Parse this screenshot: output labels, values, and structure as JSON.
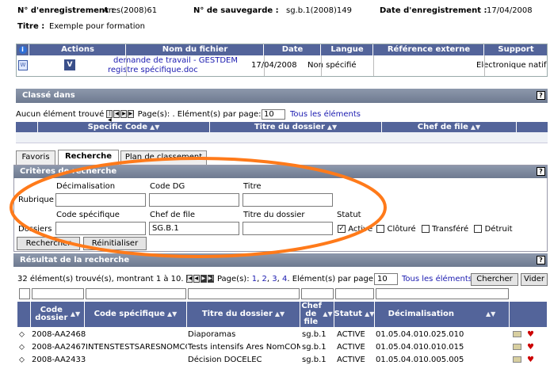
{
  "record": {
    "enr_label": "N° d'enregistrement :",
    "enr_value": "Ares(2008)61",
    "sauv_label": "N° de sauvegarde :",
    "sauv_value": "sg.b.1(2008)149",
    "date_label": "Date d'enregistrement :",
    "date_value": "17/04/2008",
    "titre_label": "Titre :",
    "titre_value": "Exemple pour formation"
  },
  "attachments": {
    "headers": [
      "Actions",
      "Nom du fichier",
      "Date",
      "Langue",
      "Référence externe",
      "Support"
    ],
    "row": {
      "file_line1": "demande de travail - GESTDEM",
      "file_line2": "registre spécifique.doc",
      "date": "17/04/2008",
      "langue": "Non spécifié",
      "ref": "",
      "support": "Electronique natif"
    }
  },
  "classe": {
    "title": "Classé dans",
    "pager_prefix": "Aucun élément trouvé",
    "pager_pages": "Page(s): . Elément(s) par page:",
    "per_page": "10",
    "all_link": "Tous les éléments",
    "headers": [
      "Specific Code",
      "Titre du dossier",
      "Chef de file"
    ]
  },
  "tabs": [
    "Favoris",
    "Recherche",
    "Plan de classement"
  ],
  "criteria": {
    "title": "Critères de recherche",
    "rubrique_label": "Rubrique",
    "dossiers_label": "Dossiers",
    "decimalisation_label": "Décimalisation",
    "code_dg_label": "Code DG",
    "titre_label": "Titre",
    "code_spec_label": "Code spécifique",
    "chef_label": "Chef de file",
    "titre_dossier_label": "Titre du dossier",
    "chef_value": "SG.B.1",
    "statut_label": "Statut",
    "statut_options": [
      "Active",
      "Clôturé",
      "Transféré",
      "Détruit"
    ],
    "search_btn": "Rechercher",
    "reset_btn": "Réinitialiser"
  },
  "results": {
    "title": "Résultat de la recherche",
    "count_text": "32 élément(s) trouvé(s), montrant 1 à 10.",
    "pages_label": "Page(s):",
    "pages": [
      "1",
      "2",
      "3",
      "4"
    ],
    "per_page_label": "Elément(s) par page:",
    "per_page": "10",
    "all_link": "Tous les éléments",
    "search_btn": "Chercher",
    "clear_btn": "Vider",
    "headers": [
      "Code dossier",
      "Code spécifique",
      "Titre du dossier",
      "Chef de file",
      "Statut",
      "Décimalisation"
    ],
    "rows": [
      {
        "code": "2008-AA2468",
        "spec": "",
        "titre": "Diaporamas",
        "chef": "sg.b.1",
        "statut": "ACTIVE",
        "dec": "01.05.04.010.025.010"
      },
      {
        "code": "2008-AA2467",
        "spec": "INTENSTESTSARESNOMCO",
        "titre": "Tests intensifs Ares NomCOM",
        "chef": "sg.b.1",
        "statut": "ACTIVE",
        "dec": "01.05.04.010.010.015"
      },
      {
        "code": "2008-AA2433",
        "spec": "",
        "titre": "Décision DOCELEC",
        "chef": "sg.b.1",
        "statut": "ACTIVE",
        "dec": "01.05.04.010.005.005"
      }
    ]
  },
  "colors": {
    "accent": "#ff7a1a",
    "header_blue": "#53649a",
    "section_gray": "#7a8498"
  }
}
